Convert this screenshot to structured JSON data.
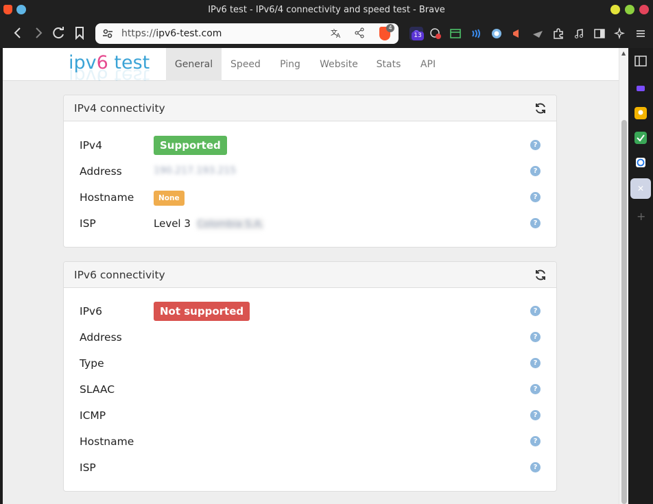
{
  "window": {
    "title": "IPv6 test - IPv6/4 connectivity and speed test - Brave"
  },
  "toolbar": {
    "url_protocol": "https://",
    "url_host": "ipv6-test.com",
    "shield_count": "4",
    "extension_badge": "13"
  },
  "site": {
    "logo": {
      "part1": "ipv",
      "part2": "6",
      "part3": " test"
    },
    "tabs": [
      "General",
      "Speed",
      "Ping",
      "Website",
      "Stats",
      "API"
    ],
    "active_tab": "General"
  },
  "ipv4": {
    "title": "IPv4 connectivity",
    "rows": {
      "support": {
        "label": "IPv4",
        "value": "Supported"
      },
      "address": {
        "label": "Address",
        "value": "190.217.193.215"
      },
      "hostname": {
        "label": "Hostname",
        "value": "None"
      },
      "isp": {
        "label": "ISP",
        "value": "Level 3",
        "value_hidden": "Colombia S.A."
      }
    }
  },
  "ipv6": {
    "title": "IPv6 connectivity",
    "rows": {
      "support": {
        "label": "IPv6",
        "value": "Not supported"
      },
      "address": {
        "label": "Address"
      },
      "type": {
        "label": "Type"
      },
      "slaac": {
        "label": "SLAAC"
      },
      "icmp": {
        "label": "ICMP"
      },
      "hostname": {
        "label": "Hostname"
      },
      "isp": {
        "label": "ISP"
      }
    }
  },
  "help_glyph": "?",
  "colors": {
    "supported": "#5cb85c",
    "not_supported": "#d9534f",
    "none": "#f0ad4e"
  }
}
